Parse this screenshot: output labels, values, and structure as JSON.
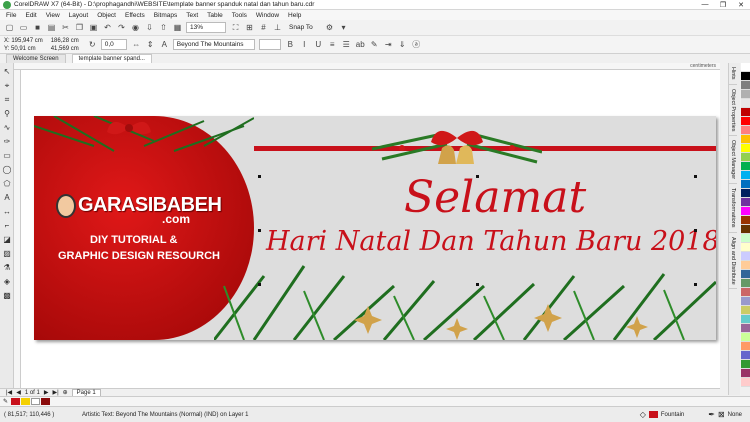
{
  "window": {
    "title": "CorelDRAW X7 (64-Bit) - D:\\prophagandhi\\WEBSITE\\template banner spanduk natal dan tahun baru.cdr",
    "controls": [
      "—",
      "❐",
      "✕"
    ]
  },
  "menu": [
    "File",
    "Edit",
    "View",
    "Layout",
    "Object",
    "Effects",
    "Bitmaps",
    "Text",
    "Table",
    "Tools",
    "Window",
    "Help"
  ],
  "toolbar": {
    "zoom": "13%",
    "snap": "Snap To"
  },
  "properties": {
    "x": "X: 195,947 cm",
    "y": "Y: 50,91 cm",
    "w": "186,28 cm",
    "h": "41,569 cm",
    "angle": "0,0",
    "font": "Beyond The Mountains"
  },
  "tabs": [
    {
      "label": "Welcome Screen"
    },
    {
      "label": "template banner spand..."
    }
  ],
  "ruler": {
    "unit": "centimeters"
  },
  "dockers": [
    "Hints",
    "Object Properties",
    "Object Manager",
    "Transformations",
    "Align and Distribute"
  ],
  "banner": {
    "brand_part1": "GARASIBABEH",
    "brand_part2": ".com",
    "tagline1": "DIY TUTORIAL &",
    "tagline2": "GRAPHIC DESIGN RESOURCH",
    "heading": "Selamat",
    "subheading": "Hari Natal Dan Tahun Baru 2018",
    "colors": {
      "red": "#c8101a",
      "pine": "#1f6e1f",
      "gold": "#d1a24a",
      "bg": "#dddddd"
    }
  },
  "pagenav": {
    "pages": "1 of 1",
    "page_tab": "Page 1"
  },
  "status": {
    "coords": "( 81,517; 110,446 )",
    "info": "Artistic Text: Beyond The Mountains (Normal) (IND) on Layer 1",
    "fill": "Fountain",
    "outline": "None"
  },
  "palette": [
    "#ffffff",
    "#000000",
    "#7f7f7f",
    "#b0b0b0",
    "#e8e8e8",
    "#c00000",
    "#ff0000",
    "#ff7f7f",
    "#ffc000",
    "#ffff00",
    "#92d050",
    "#00b050",
    "#00b0f0",
    "#0070c0",
    "#002060",
    "#7030a0",
    "#ff00ff",
    "#993300",
    "#663300",
    "#ccffcc",
    "#ffffcc",
    "#ccccff",
    "#ffcc99",
    "#336699",
    "#669966",
    "#cc6666",
    "#9999cc",
    "#cccc66",
    "#66cccc",
    "#996699",
    "#ccff99",
    "#ff9966",
    "#6666cc",
    "#339933",
    "#993366",
    "#ffcccc"
  ]
}
